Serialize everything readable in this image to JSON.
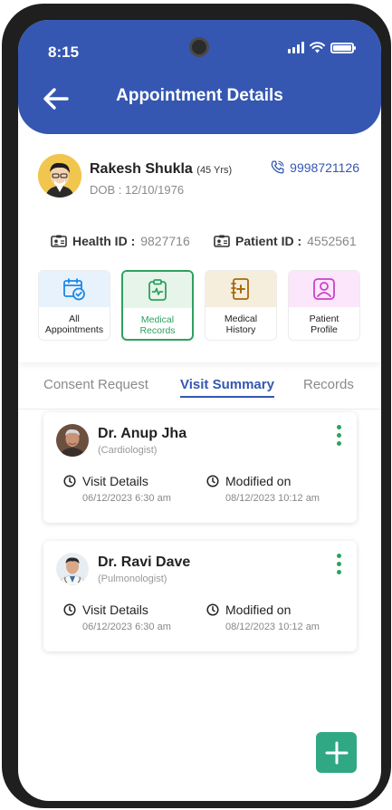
{
  "status_bar": {
    "time": "8:15"
  },
  "header": {
    "title": "Appointment Details"
  },
  "patient": {
    "name": "Rakesh Shukla",
    "age": "(45 Yrs)",
    "dob": "DOB : 12/10/1976",
    "phone": "9998721126",
    "health_id_label": "Health ID :",
    "health_id": "9827716",
    "patient_id_label": "Patient ID :",
    "patient_id": "4552561"
  },
  "tiles": [
    {
      "line1": "All",
      "line2": "Appointments",
      "color": "#1e88e5",
      "bg": "#e8f2fd"
    },
    {
      "line1": "Medical",
      "line2": "Records",
      "color": "#2ea15f",
      "bg": "#e6f4ea"
    },
    {
      "line1": "Medical",
      "line2": "History",
      "color": "#a56b0c",
      "bg": "#f6eedd"
    },
    {
      "line1": "Patient",
      "line2": "Profile",
      "color": "#c843c8",
      "bg": "#fbe6fb"
    }
  ],
  "tabs": [
    "Consent Request",
    "Visit Summary",
    "Records"
  ],
  "visits": [
    {
      "doctor": "Dr. Anup Jha",
      "specialty": "(Cardiologist)",
      "visit_label": "Visit Details",
      "visit_date": "06/12/2023 6:30 am",
      "modified_label": "Modified on",
      "modified_date": "08/12/2023 10:12 am"
    },
    {
      "doctor": "Dr. Ravi Dave",
      "specialty": "(Pulmonologist)",
      "visit_label": "Visit Details",
      "visit_date": "06/12/2023 6:30 am",
      "modified_label": "Modified on",
      "modified_date": "08/12/2023 10:12 am"
    }
  ],
  "colors": {
    "primary": "#3557b2",
    "accent": "#2ea15f",
    "fab": "#2fa883"
  }
}
